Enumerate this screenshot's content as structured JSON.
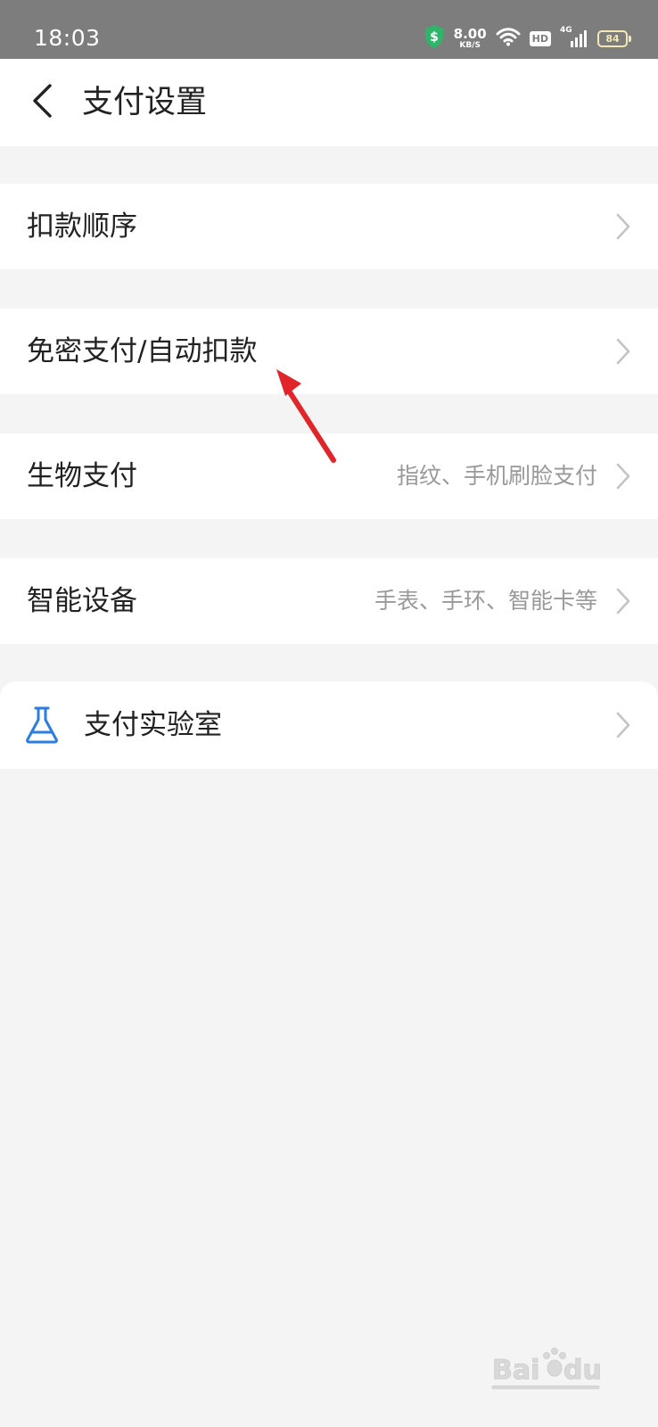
{
  "status_bar": {
    "time": "18:03",
    "net_speed_value": "8.00",
    "net_speed_unit": "KB/S",
    "hd_label": "HD",
    "network_label": "4G",
    "battery_level": "84",
    "battery_color": "#f3e8b4",
    "shield_color": "#2fb56a"
  },
  "header": {
    "title": "支付设置",
    "back_icon": "chevron-left-icon"
  },
  "settings": {
    "items": [
      {
        "label": "扣款顺序",
        "desc": ""
      },
      {
        "label": "免密支付/自动扣款",
        "desc": ""
      },
      {
        "label": "生物支付",
        "desc": "指纹、手机刷脸支付"
      },
      {
        "label": "智能设备",
        "desc": "手表、手环、智能卡等"
      }
    ],
    "lab": {
      "label": "支付实验室",
      "icon": "flask-icon",
      "icon_color": "#2b7de0"
    }
  },
  "theme": {
    "background": "#f4f4f4",
    "surface": "#ffffff",
    "status_bar_bg": "#7d7d7d",
    "chevron_color": "#c4c4c4",
    "annotation_color": "#e0262a"
  }
}
